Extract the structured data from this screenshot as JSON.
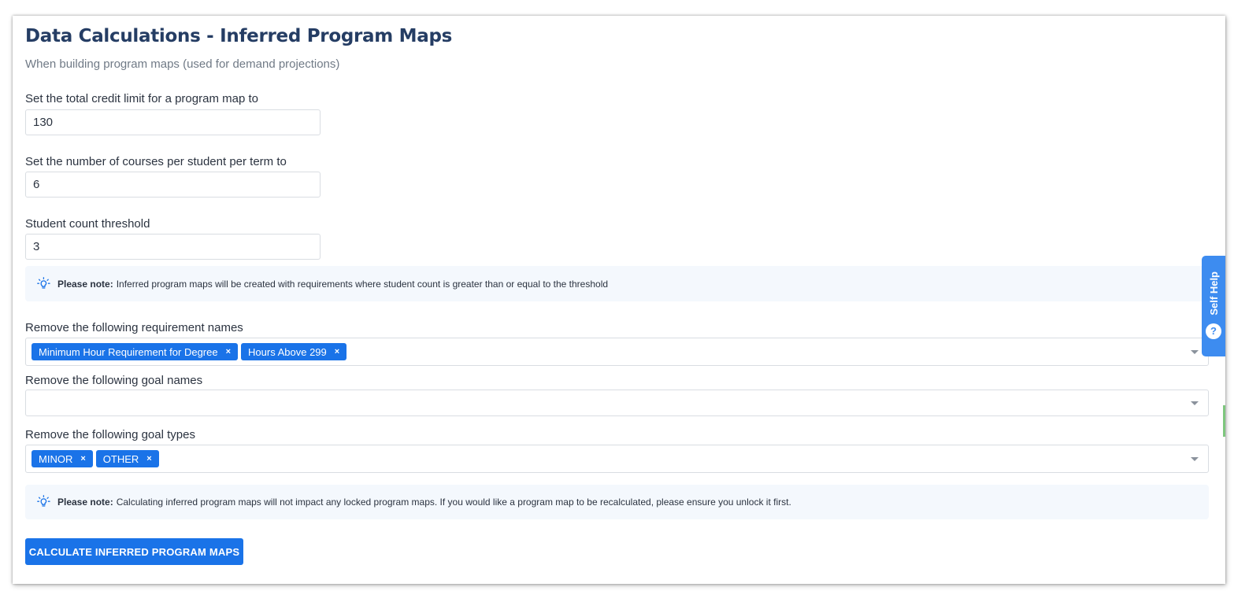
{
  "header": {
    "title": "Data Calculations - Inferred Program Maps",
    "subtitle": "When building program maps (used for demand projections)"
  },
  "fields": {
    "credit_limit": {
      "label": "Set the total credit limit for a program map to",
      "value": "130"
    },
    "courses_per_term": {
      "label": "Set the number of courses per student per term to",
      "value": "6"
    },
    "student_threshold": {
      "label": "Student count threshold",
      "value": "3"
    }
  },
  "note_threshold": {
    "bold": "Please note:",
    "text": "Inferred program maps will be created with requirements where student count is greater than or equal to the threshold"
  },
  "remove_requirements": {
    "label": "Remove the following requirement names",
    "tags": [
      "Minimum Hour Requirement for Degree",
      "Hours Above 299"
    ]
  },
  "remove_goal_names": {
    "label": "Remove the following goal names",
    "tags": []
  },
  "remove_goal_types": {
    "label": "Remove the following goal types",
    "tags": [
      "MINOR",
      "OTHER"
    ]
  },
  "note_locked": {
    "bold": "Please note:",
    "text": "Calculating inferred program maps will not impact any locked program maps. If you would like a program map to be recalculated, please ensure you unlock it first."
  },
  "actions": {
    "calculate_label": "CALCULATE INFERRED PROGRAM MAPS"
  },
  "self_help": {
    "label": "Self Help",
    "icon_glyph": "?"
  },
  "icons": {
    "tag_remove": "×",
    "note": "lightbulb-icon",
    "dropdown": "chevron-down-icon"
  },
  "colors": {
    "title": "#253d64",
    "primary": "#1a73e8",
    "note_bg": "#f4f8fd",
    "self_help": "#3d8cf0"
  }
}
